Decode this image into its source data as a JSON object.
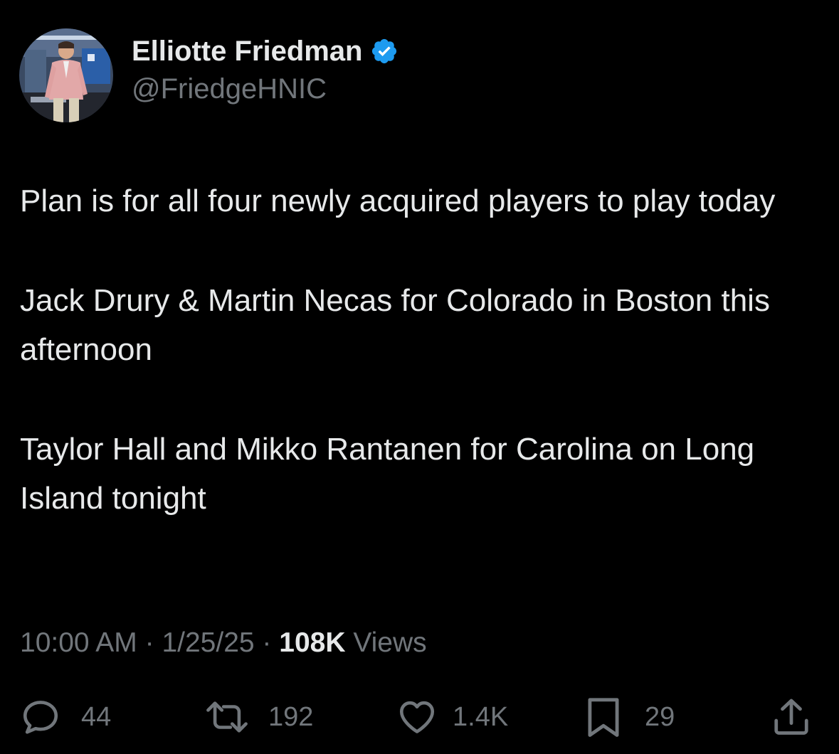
{
  "author": {
    "display_name": "Elliotte Friedman",
    "handle": "@FriedgeHNIC",
    "verified_icon": "verified-badge-icon",
    "verified_color": "#1d9bf0"
  },
  "tweet": {
    "paragraphs": [
      "Plan is for all four newly acquired players to play today",
      "Jack Drury & Martin Necas for Colorado in Boston this afternoon",
      "Taylor Hall and Mikko Rantanen for Carolina on Long Island tonight"
    ]
  },
  "meta": {
    "time": "10:00 AM",
    "separator": " · ",
    "date": "1/25/25",
    "views_count": "108K",
    "views_label": "Views"
  },
  "actions": {
    "replies": {
      "icon": "reply-icon",
      "count": "44"
    },
    "reposts": {
      "icon": "repost-icon",
      "count": "192"
    },
    "likes": {
      "icon": "heart-icon",
      "count": "1.4K"
    },
    "bookmarks": {
      "icon": "bookmark-icon",
      "count": "29"
    },
    "share": {
      "icon": "share-icon"
    }
  },
  "colors": {
    "background": "#000000",
    "primary_text": "#e7e9ea",
    "secondary_text": "#71767b"
  }
}
